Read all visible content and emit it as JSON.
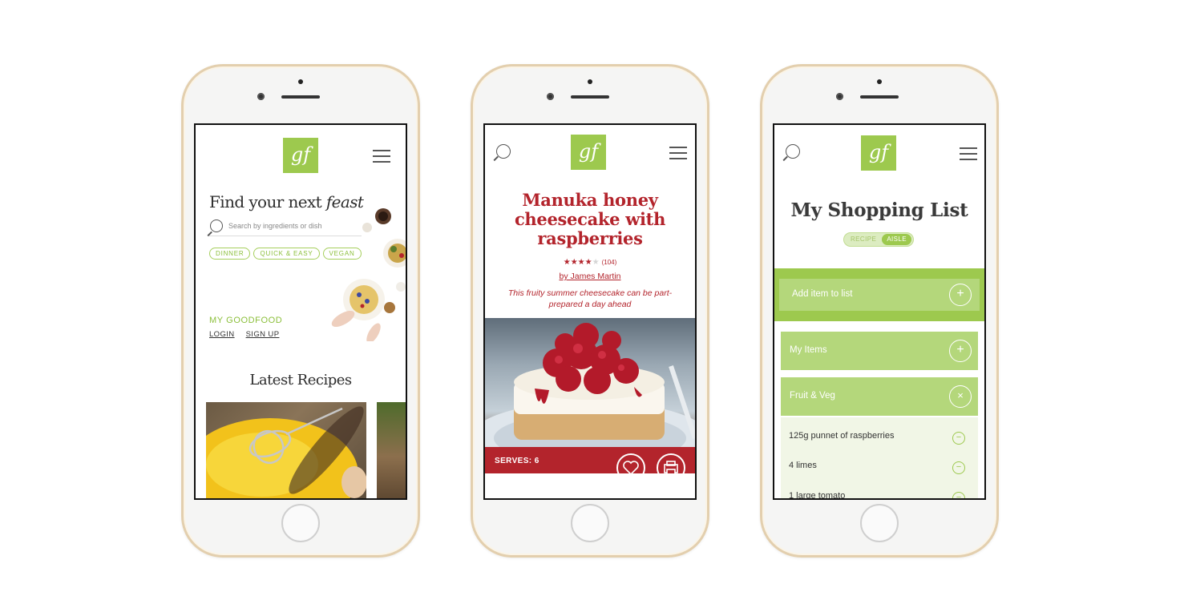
{
  "colors": {
    "brand_green": "#9dc94e",
    "recipe_red": "#b3242c",
    "phone_gold": "#e3cfae"
  },
  "common": {
    "logo_text": "gf"
  },
  "home": {
    "hero_prefix": "Find your next ",
    "hero_emphasis": "feast",
    "search_placeholder": "Search by ingredients or dish",
    "tags": [
      "DINNER",
      "QUICK & EASY",
      "VEGAN"
    ],
    "my_goodfood": "MY GOODFOOD",
    "login": "LOGIN",
    "signup": "SIGN UP",
    "latest_heading": "Latest Recipes"
  },
  "recipe": {
    "title": "Manuka honey cheesecake with raspberries",
    "rating": 4,
    "rating_max": 5,
    "rating_count": "(104)",
    "author": "by James Martin",
    "description": "This fruity summer cheesecake can be part-prepared a day ahead",
    "serves": "SERVES: 6"
  },
  "shopping": {
    "title": "My Shopping List",
    "toggle_left": "RECIPE",
    "toggle_right": "AISLE",
    "add_item": "Add item to list",
    "section_my_items": "My Items",
    "section_fruit_veg": "Fruit & Veg",
    "items": [
      "125g punnet of raspberries",
      "4 limes",
      "1 large tomato"
    ]
  }
}
